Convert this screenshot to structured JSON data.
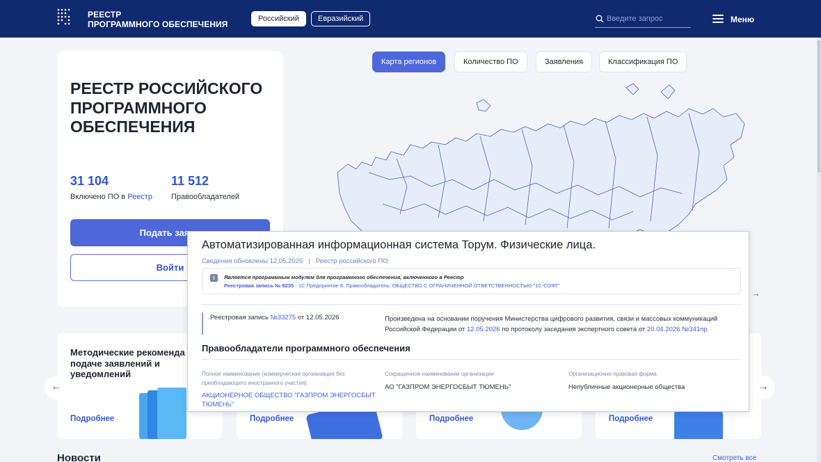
{
  "header": {
    "logo_line1": "РЕЕСТР",
    "logo_line2": "ПРОГРАММНОГО ОБЕСПЕЧЕНИЯ",
    "tabs": [
      {
        "label": "Российский",
        "active": true
      },
      {
        "label": "Евразийский",
        "active": false
      }
    ],
    "search_placeholder": "Введите запрос",
    "menu_label": "Меню",
    "icons": [
      "logo-dots-icon",
      "search-icon",
      "menu-icon"
    ]
  },
  "hero": {
    "title": "РЕЕСТР РОССИЙСКОГО ПРОГРАММНОГО ОБЕСПЕЧЕНИЯ",
    "stats": [
      {
        "value": "31 104",
        "label_prefix": "Включено ПО в ",
        "label_link": "Реестр"
      },
      {
        "value": "11 512",
        "label_prefix": "Правообладателей",
        "label_link": ""
      }
    ],
    "primary_button": "Подать заявл",
    "secondary_button": "Войти"
  },
  "map_tabs": [
    {
      "label": "Карта регионов",
      "active": true
    },
    {
      "label": "Количество ПО",
      "active": false
    },
    {
      "label": "Заявления",
      "active": false
    },
    {
      "label": "Классификация ПО",
      "active": false
    }
  ],
  "map_arrow": "→",
  "cards": [
    {
      "title": "Методические рекоменда по подаче заявлений и уведомлений",
      "more": "Подробнее"
    },
    {
      "title": "",
      "more": "Подробнее"
    },
    {
      "title": "",
      "more": "Подробнее"
    },
    {
      "title": "",
      "more": "Подробнее"
    }
  ],
  "carousel": {
    "prev": "←",
    "next": "→"
  },
  "news": {
    "title": "Новости",
    "see_all": "Смотреть все"
  },
  "popup": {
    "title": "Автоматизированная информационная система Торум. Физические лица.",
    "updated": "Сведения обновлены 12.05.2026",
    "separator": "|",
    "registry": "Реестр российского ПО",
    "module_notice": "Является программным модулем для программного обеспечения, включенного в Реестр",
    "module_record_label": "Реестровая запись № 8235",
    "module_record_rest": " - 1С:Предприятие 8, Правообладатель: ОБЩЕСТВО С ОГРАНИЧЕННОЙ ОТВЕТСТВЕННОСТЬЮ \"1С-СОФТ\"",
    "record_prefix": "Реестровая запись ",
    "record_number": "№33275",
    "record_suffix": " от 12.05.2026",
    "basis_line1": "Произведена на основании поручения Министерства цифрового развития, связи и массовых коммуникаций",
    "basis_line2_prefix": "Российской Федерации от ",
    "basis_date": "12.05.2026",
    "basis_line2_mid": " по протоколу заседания экспертного совета от ",
    "basis_protocol": "20.04.2026 №341пр",
    "owners_title": "Правообладатели программного обеспечения",
    "owners_columns": [
      {
        "header": "Полное наименование (коммерческая организация без преобладающего иностранного участия)",
        "value": "АКЦИОНЕРНОЕ ОБЩЕСТВО \"ГАЗПРОМ ЭНЕРГОСБЫТ ТЮМЕНЬ\""
      },
      {
        "header": "Сокращенное наименование организации",
        "value": "АО \"ГАЗПРОМ ЭНЕРГОСБЫТ ТЮМЕНЬ\""
      },
      {
        "header": "Организационно-правовая форма",
        "value": "Непубличные акционерные общества"
      }
    ]
  }
}
